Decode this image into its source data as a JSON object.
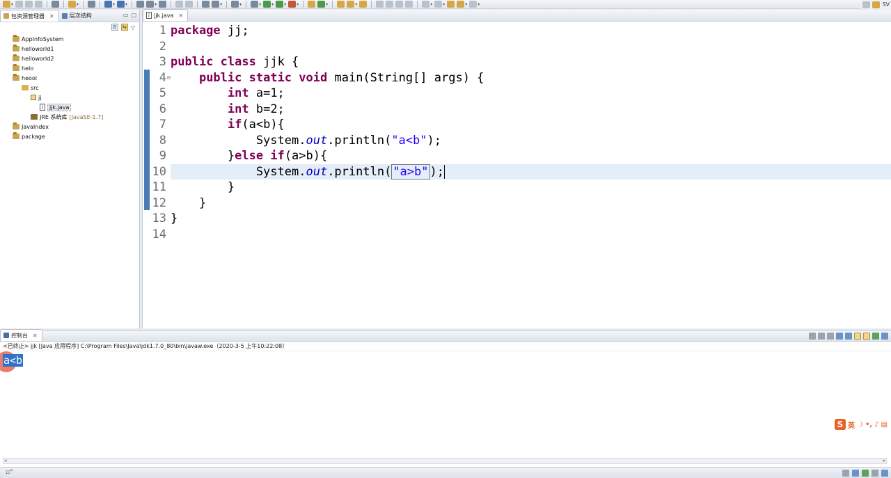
{
  "left_panel": {
    "tabs": [
      {
        "label": "包资源管理器",
        "active": true
      },
      {
        "label": "层次结构",
        "active": false
      }
    ],
    "tree": [
      {
        "label": "AppInfoSystem",
        "indent": 0,
        "icon": "project-icon"
      },
      {
        "label": "helloworld1",
        "indent": 0,
        "icon": "project-icon"
      },
      {
        "label": "helloworld2",
        "indent": 0,
        "icon": "project-icon"
      },
      {
        "label": "helo",
        "indent": 0,
        "icon": "project-icon"
      },
      {
        "label": "heool",
        "indent": 0,
        "icon": "project-icon"
      },
      {
        "label": "src",
        "indent": 1,
        "icon": "source-folder-icon"
      },
      {
        "label": "jj",
        "indent": 2,
        "icon": "package-icon"
      },
      {
        "label": "jjk.java",
        "indent": 3,
        "icon": "java-file-icon",
        "selected": true
      },
      {
        "label": "JRE 系统库",
        "suffix": "[JavaSE-1.7]",
        "indent": 2,
        "icon": "library-icon"
      },
      {
        "label": "JavaIndex",
        "indent": 0,
        "icon": "project-icon"
      },
      {
        "label": "package",
        "indent": 0,
        "icon": "project-icon"
      }
    ]
  },
  "editor": {
    "tab_label": "jjk.java",
    "lines": [
      {
        "n": "1",
        "tokens": [
          {
            "t": "package",
            "c": "kw"
          },
          {
            "t": " jj;"
          }
        ]
      },
      {
        "n": "2",
        "tokens": []
      },
      {
        "n": "3",
        "tokens": [
          {
            "t": "public",
            "c": "kw"
          },
          {
            "t": " "
          },
          {
            "t": "class",
            "c": "kw"
          },
          {
            "t": " jjk {"
          }
        ]
      },
      {
        "n": "4",
        "fold": true,
        "tokens": [
          {
            "t": "    "
          },
          {
            "t": "public",
            "c": "kw"
          },
          {
            "t": " "
          },
          {
            "t": "static",
            "c": "kw"
          },
          {
            "t": " "
          },
          {
            "t": "void",
            "c": "kw"
          },
          {
            "t": " main(String[] args) {"
          }
        ]
      },
      {
        "n": "5",
        "tokens": [
          {
            "t": "        "
          },
          {
            "t": "int",
            "c": "kw"
          },
          {
            "t": " a=1;"
          }
        ]
      },
      {
        "n": "6",
        "tokens": [
          {
            "t": "        "
          },
          {
            "t": "int",
            "c": "kw"
          },
          {
            "t": " b=2;"
          }
        ]
      },
      {
        "n": "7",
        "tokens": [
          {
            "t": "        "
          },
          {
            "t": "if",
            "c": "kw"
          },
          {
            "t": "(a<b){"
          }
        ]
      },
      {
        "n": "8",
        "tokens": [
          {
            "t": "            System."
          },
          {
            "t": "out",
            "c": "fld"
          },
          {
            "t": ".println("
          },
          {
            "t": "\"a<b\"",
            "c": "str"
          },
          {
            "t": ");"
          }
        ]
      },
      {
        "n": "9",
        "tokens": [
          {
            "t": "        }"
          },
          {
            "t": "else",
            "c": "kw"
          },
          {
            "t": " "
          },
          {
            "t": "if",
            "c": "kw"
          },
          {
            "t": "(a>b){"
          }
        ]
      },
      {
        "n": "10",
        "current": true,
        "tokens": [
          {
            "t": "            System."
          },
          {
            "t": "out",
            "c": "fld"
          },
          {
            "t": ".println("
          },
          {
            "t": "\"a>b\"",
            "c": "str boxed"
          },
          {
            "t": ");",
            "c": "caret"
          }
        ]
      },
      {
        "n": "11",
        "tokens": [
          {
            "t": "        }"
          }
        ]
      },
      {
        "n": "12",
        "tokens": [
          {
            "t": "    }"
          }
        ]
      },
      {
        "n": "13",
        "tokens": [
          {
            "t": "}"
          }
        ]
      },
      {
        "n": "14",
        "tokens": []
      }
    ]
  },
  "console": {
    "tab_label": "控制台",
    "info": "<已终止> jjk [Java 应用程序] C:\\Program Files\\Java\\jdk1.7.0_80\\bin\\javaw.exe（2020-3-5 上午10:22:08）",
    "output": "a<b"
  },
  "toolbar": {
    "perspective_label": "SV"
  },
  "ime": {
    "logo": "S",
    "mode": "英"
  }
}
